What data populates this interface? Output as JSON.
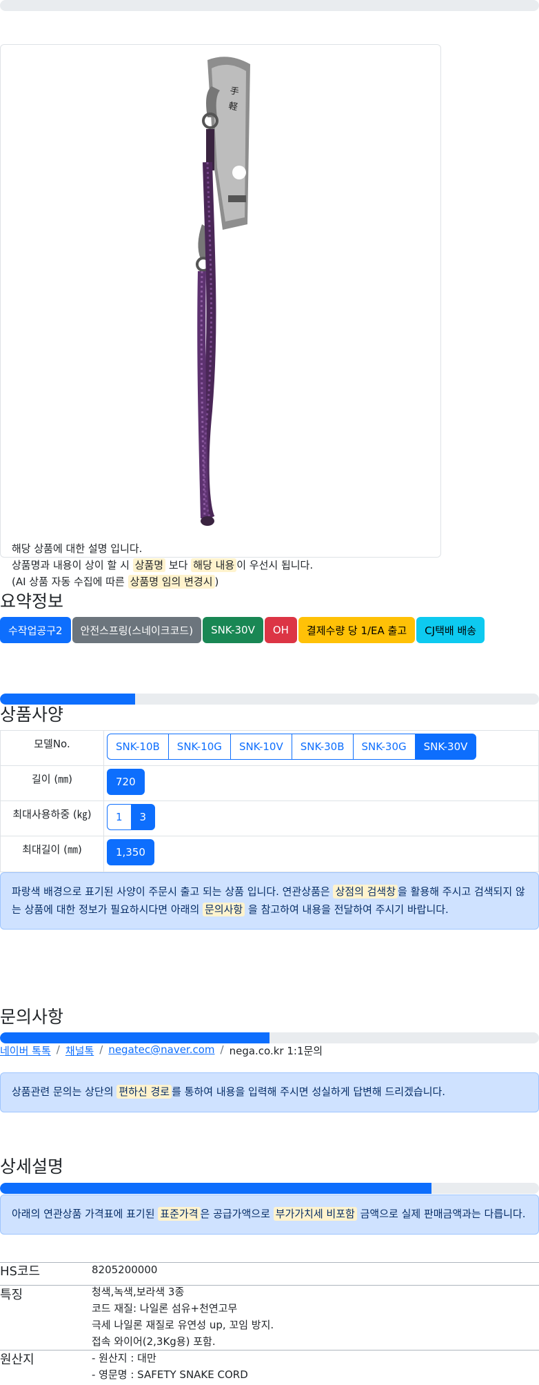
{
  "description_lines": {
    "line1": "해당 상품에 대한 설명 입니다.",
    "line2_a": "상품명과 내용이 상이 할 시",
    "line2_hl1": "상품명",
    "line2_b": "보다",
    "line2_hl2": "해당 내용",
    "line2_c": "이 우선시 됩니다.",
    "line3_a": "(AI 상품 자동 수집에 따른",
    "line3_hl": "상품명 임의 변경시",
    "line3_b": ")"
  },
  "summary": {
    "title": "요약정보",
    "badges": [
      {
        "label": "수작업공구2",
        "color": "#0d6efd",
        "text_color": "#ffffff"
      },
      {
        "label": "안전스프링(스네이크코드)",
        "color": "#6c757d",
        "text_color": "#ffffff"
      },
      {
        "label": "SNK-30V",
        "color": "#198754",
        "text_color": "#ffffff"
      },
      {
        "label": "OH",
        "color": "#dc3545",
        "text_color": "#ffffff"
      },
      {
        "label": "결제수량 당 1/EA 출고",
        "color": "#ffc107",
        "text_color": "#000000"
      },
      {
        "label": "CJ택배 배송",
        "color": "#0dcaf0",
        "text_color": "#000000"
      }
    ]
  },
  "specs": {
    "title": "상품사양",
    "progress": 0.25,
    "rows": [
      {
        "label": "모델No.",
        "options": [
          "SNK-10B",
          "SNK-10G",
          "SNK-10V",
          "SNK-30B",
          "SNK-30G",
          "SNK-30V"
        ],
        "selected": "SNK-30V"
      },
      {
        "label": "길이 (㎜)",
        "options": [
          "720"
        ],
        "selected": "720"
      },
      {
        "label": "최대사용하중 (㎏)",
        "options": [
          "1",
          "3"
        ],
        "selected": "3"
      },
      {
        "label": "최대길이 (㎜)",
        "options": [
          "1,350"
        ],
        "selected": "1,350"
      }
    ],
    "notice_a": "파랑색 배경으로 표기된 사양이 주문시 출고 되는 상품 입니다. 연관상품은",
    "notice_hl1": "상점의 검색창",
    "notice_b": "을 활용해 주시고 검색되지 않는 상품에 대한 정보가 필요하시다면 아래의",
    "notice_hl2": "문의사항",
    "notice_c": "을 참고하여 내용을 전달하여 주시기 바랍니다."
  },
  "inquiry": {
    "title": "문의사항",
    "progress": 0.5,
    "links": [
      "네이버 톡톡",
      "채널톡",
      "negatec@naver.com"
    ],
    "plain": "nega.co.kr 1:1문의",
    "notice_a": "상품관련 문의는 상단의",
    "notice_hl": "편하신 경로",
    "notice_b": "를 통하여 내용을 입력해 주시면 성실하게 답변해 드리겠습니다."
  },
  "detail": {
    "title": "상세설명",
    "progress": 0.8,
    "notice_a": "아래의 연관상품 가격표에 표기된",
    "notice_hl1": "표준가격",
    "notice_b": "은 공급가액으로",
    "notice_hl2": "부가가치세 비포함",
    "notice_c": "금액으로 실제 판매금액과는 다릅니다."
  },
  "info": {
    "hs_label": "HS코드",
    "hs_value": "8205200000",
    "feature_label": "특징",
    "features": [
      "청색,녹색,보라색 3종",
      "코드 재질: 나일론 섬유+천연고무",
      "극세 나일론 재질로 유연성 up, 꼬임 방지.",
      "접속 와이어(2,3Kg용) 포함."
    ],
    "origin_label": "원산지",
    "origins": [
      "- 원산지 : 대만",
      "- 영문명 : SAFETY SNAKE CORD"
    ]
  }
}
